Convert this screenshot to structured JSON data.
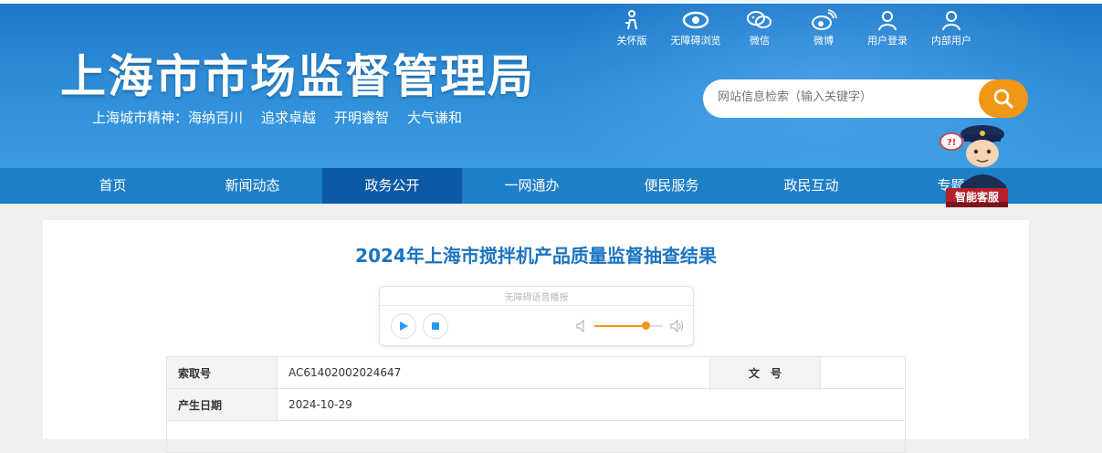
{
  "header": {
    "site_title": "上海市市场监督管理局",
    "slogan": [
      "上海城市精神：海纳百川",
      "追求卓越",
      "开明睿智",
      "大气谦和"
    ],
    "top_links": [
      {
        "label": "关怀版",
        "icon": "care-icon"
      },
      {
        "label": "无障碍浏览",
        "icon": "eye-icon"
      },
      {
        "label": "微信",
        "icon": "wechat-icon"
      },
      {
        "label": "微博",
        "icon": "weibo-icon"
      },
      {
        "label": "用户登录",
        "icon": "user-icon"
      },
      {
        "label": "内部用户",
        "icon": "user-icon"
      }
    ],
    "search_placeholder": "网站信息检索（输入关键字）"
  },
  "nav": {
    "items": [
      "首页",
      "新闻动态",
      "政务公开",
      "一网通办",
      "便民服务",
      "政民互动",
      "专题"
    ],
    "active": "政务公开"
  },
  "assistant": {
    "label": "智能客服"
  },
  "article": {
    "title": "2024年上海市搅拌机产品质量监督抽查结果",
    "player": {
      "label": "无障碍语音播报",
      "volume": 0.75
    },
    "info": {
      "index_label": "索取号",
      "index_value": "AC61402002024647",
      "doc_label": "文　号",
      "doc_value": "",
      "date_label": "产生日期",
      "date_value": "2024-10-29"
    }
  },
  "colors": {
    "brand_blue": "#1d7fc8",
    "nav_active": "#0c5aa3",
    "accent_orange": "#f29617",
    "title_blue": "#1c74c0"
  }
}
